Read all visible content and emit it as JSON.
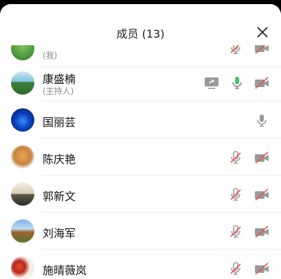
{
  "header": {
    "title": "成员 (13)"
  },
  "members": [
    {
      "name": "",
      "sub": "(我)",
      "avatar": "avatar-green",
      "mic": "muted",
      "camera": "off"
    },
    {
      "name": "康盛楠",
      "sub": "(主持人)",
      "avatar": "avatar-lake",
      "share": true,
      "mic": "active",
      "camera": "off"
    },
    {
      "name": "国丽芸",
      "sub": "",
      "avatar": "avatar-blue",
      "mic": "on",
      "camera": "none"
    },
    {
      "name": "陈庆艳",
      "sub": "",
      "avatar": "avatar-dog",
      "mic": "muted",
      "camera": "off"
    },
    {
      "name": "郭新文",
      "sub": "",
      "avatar": "avatar-sunset",
      "mic": "muted",
      "camera": "off"
    },
    {
      "name": "刘海军",
      "sub": "",
      "avatar": "avatar-temple",
      "mic": "muted",
      "camera": "off"
    },
    {
      "name": "施晴薇岚",
      "sub": "",
      "avatar": "avatar-flowers",
      "mic": "muted",
      "camera": "off"
    }
  ],
  "colors": {
    "mic_active": "#3cc46b",
    "muted_slash": "#e8534a",
    "icon_gray": "#9a9a9a"
  }
}
